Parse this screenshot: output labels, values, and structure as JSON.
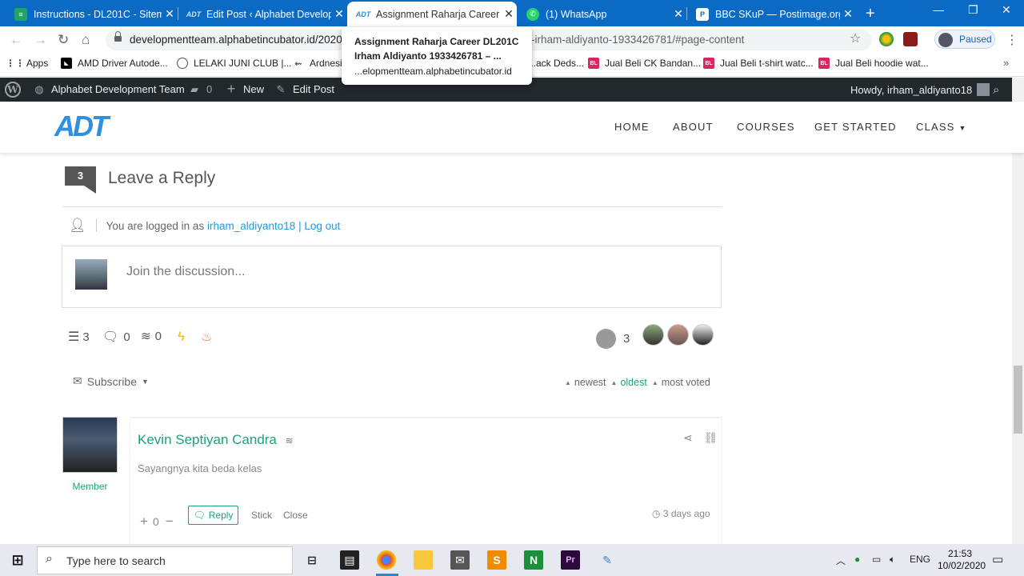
{
  "browser": {
    "tabs": [
      {
        "title": "Instructions - DL201C - Sitem",
        "favicon": "green-doc-icon"
      },
      {
        "title": "Edit Post ‹ Alphabet Developm",
        "favicon": "adt-icon"
      },
      {
        "title": "Assignment Raharja Career DL",
        "favicon": "adt-icon",
        "active": true
      },
      {
        "title": "(1) WhatsApp",
        "favicon": "whatsapp-icon"
      },
      {
        "title": "BBC SKuP — Postimage.org",
        "favicon": "postimage-icon"
      }
    ],
    "url_main": "developmentteam.alphabetincubator.id/2020/",
    "url_rest": "-irham-aldiyanto-1933426781/#page-content",
    "profile_status": "Paused",
    "bookmarks": [
      {
        "label": "Apps",
        "icon": "apps-grid-icon"
      },
      {
        "label": "AMD Driver Autode...",
        "icon": "amd-icon"
      },
      {
        "label": "LELAKI JUNI CLUB |...",
        "icon": "globe-icon"
      },
      {
        "label": "Ardnesi...",
        "icon": "ardnesi-icon"
      },
      {
        "label": "...ack Deds...",
        "icon": "blank-icon"
      },
      {
        "label": "Jual Beli CK Bandan...",
        "icon": "bl-icon"
      },
      {
        "label": "Jual Beli t-shirt watc...",
        "icon": "bl-icon"
      },
      {
        "label": "Jual Beli hoodie wat...",
        "icon": "bl-icon"
      }
    ],
    "tooltip": {
      "line1": "Assignment Raharja Career DL201C",
      "line2": "Irham Aldiyanto 1933426781 – ...",
      "line3": "...elopmentteam.alphabetincubator.id"
    }
  },
  "adminbar": {
    "site": "Alphabet Development Team",
    "comments": "0",
    "new": "New",
    "edit": "Edit Post",
    "howdy": "Howdy, irham_aldiyanto18"
  },
  "site": {
    "logo": "ADT",
    "nav": [
      "HOME",
      "ABOUT",
      "COURSES",
      "GET STARTED",
      "CLASS"
    ]
  },
  "comments": {
    "count": "3",
    "heading": "Leave a Reply",
    "logged_prefix": "You are logged in as",
    "user": "irham_aldiyanto18",
    "logout": "| Log out",
    "placeholder": "Join the discussion...",
    "stats": {
      "threads": "3",
      "replies": "0",
      "followers": "0",
      "participants": "3"
    },
    "subscribe": "Subscribe",
    "sort": {
      "newest": "newest",
      "oldest": "oldest",
      "most_voted": "most voted"
    },
    "items": [
      {
        "author": "Kevin Septiyan Candra",
        "role": "Member",
        "text": "Sayangnya kita beda kelas",
        "votes": "0",
        "reply": "Reply",
        "stick": "Stick",
        "close": "Close",
        "date": "3 days ago"
      }
    ]
  },
  "taskbar": {
    "search_placeholder": "Type here to search",
    "lang": "ENG",
    "time": "21:53",
    "date": "10/02/2020"
  },
  "colors": {
    "accent": "#1aa37a",
    "link": "#1e9be0",
    "tabstrip": "#0a6ac4",
    "adminbar": "#23282d"
  }
}
